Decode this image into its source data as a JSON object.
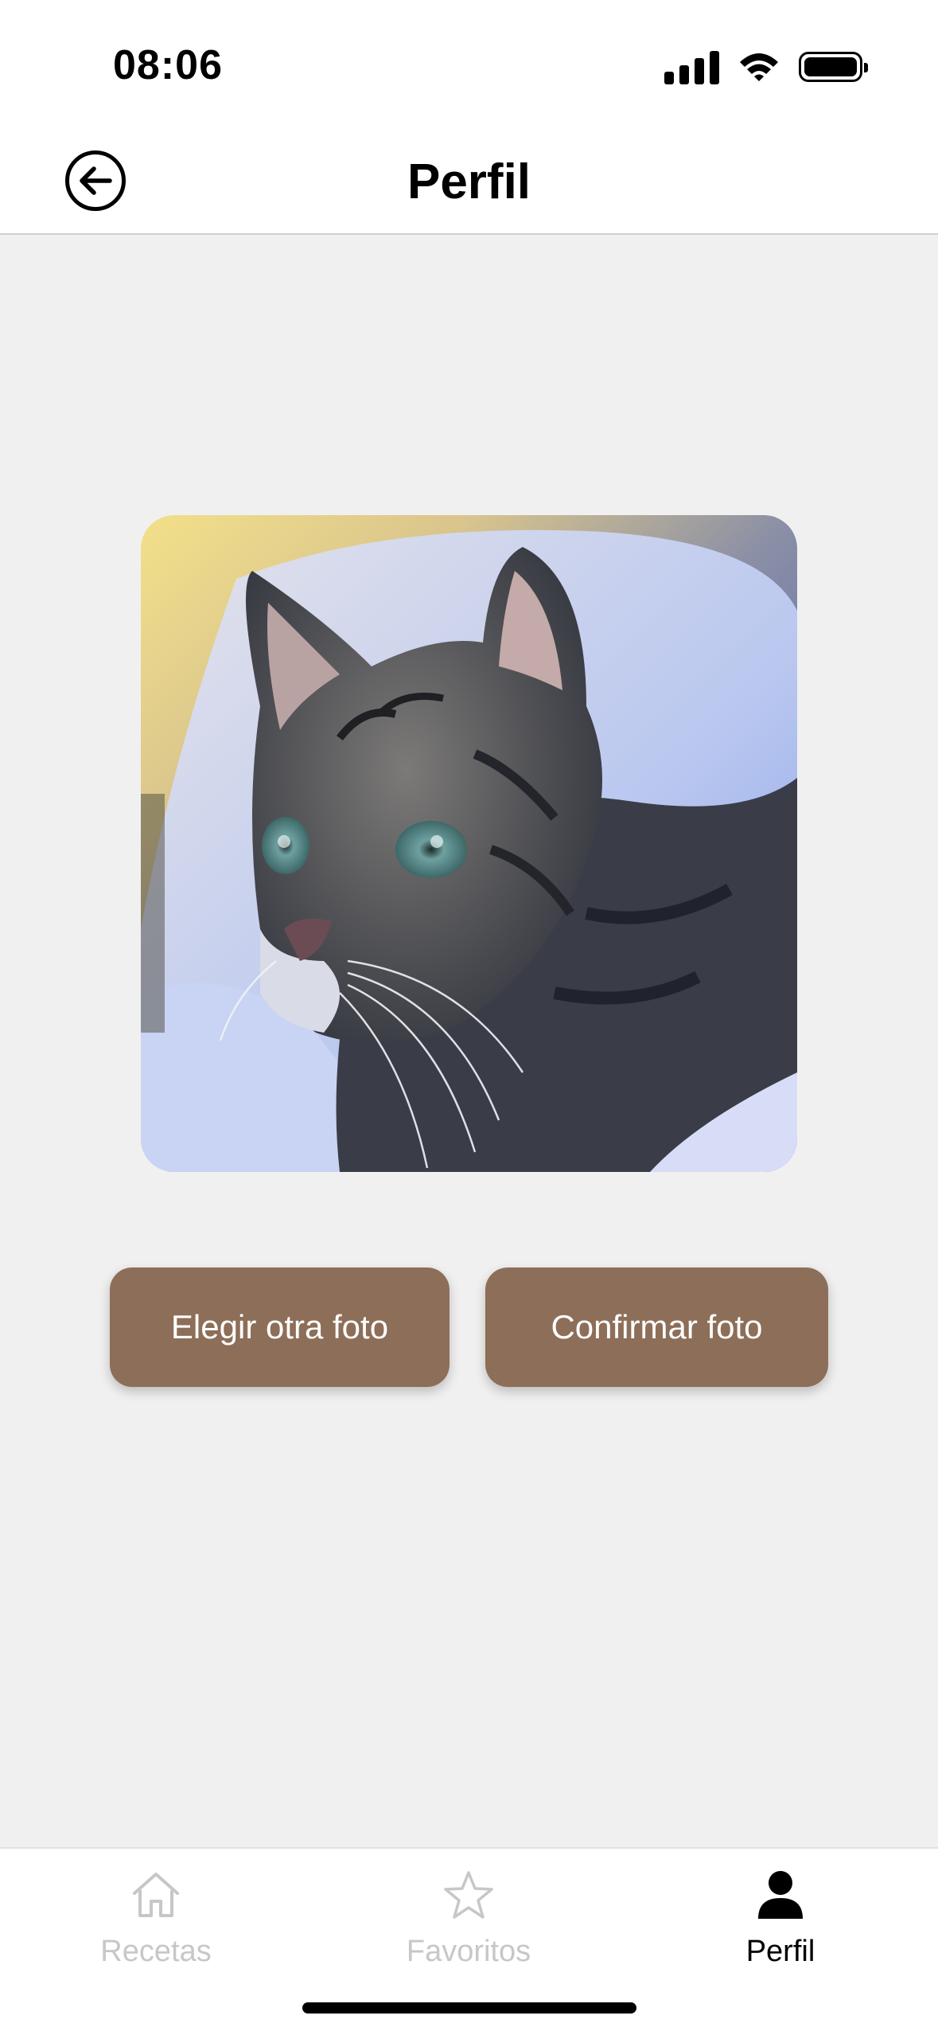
{
  "status_bar": {
    "time": "08:06",
    "icons": [
      "signal-icon",
      "wifi-icon",
      "battery-icon"
    ]
  },
  "header": {
    "title": "Perfil",
    "back_icon": "arrow-left-circle-icon"
  },
  "photo": {
    "subject": "tabby-cat-photo"
  },
  "actions": {
    "choose_other": "Elegir otra foto",
    "confirm": "Confirmar foto"
  },
  "tab_bar": {
    "tabs": [
      {
        "label": "Recetas",
        "icon": "home-icon",
        "active": false
      },
      {
        "label": "Favoritos",
        "icon": "star-icon",
        "active": false
      },
      {
        "label": "Perfil",
        "icon": "person-icon",
        "active": true
      }
    ]
  },
  "colors": {
    "accent_button": "#8d6e58",
    "background": "#f1f0f1",
    "tab_inactive": "#c7c7c7",
    "tab_active": "#000000"
  }
}
